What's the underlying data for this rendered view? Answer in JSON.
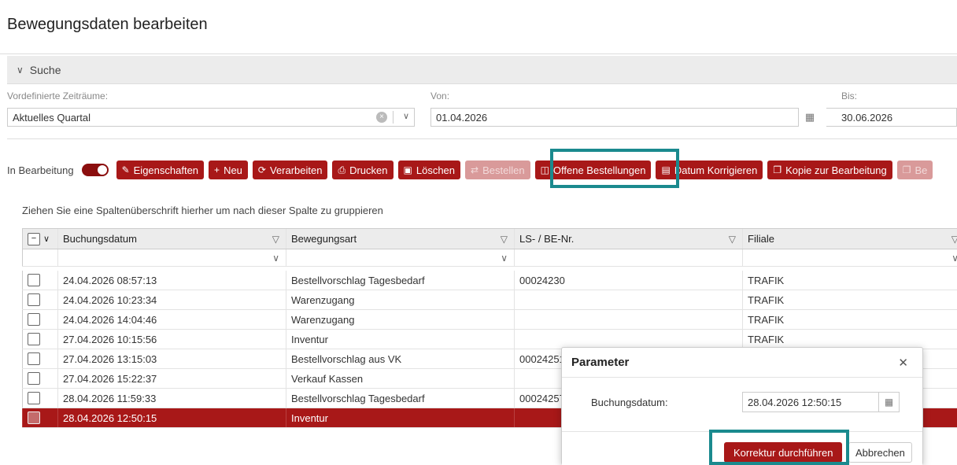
{
  "page": {
    "title": "Bewegungsdaten bearbeiten"
  },
  "search": {
    "header": "Suche",
    "predefined_label": "Vordefinierte Zeiträume:",
    "predefined_value": "Aktuelles Quartal",
    "from_label": "Von:",
    "from_value": "01.04.2026",
    "to_label": "Bis:",
    "to_value": "30.06.2026"
  },
  "toolbar": {
    "in_edit_label": "In Bearbeitung",
    "in_edit_on": true,
    "buttons": {
      "properties": "Eigenschaften",
      "new": "Neu",
      "process": "Verarbeiten",
      "print": "Drucken",
      "delete": "Löschen",
      "order": "Bestellen",
      "open_orders": "Offene Bestellungen",
      "correct_date": "Datum Korrigieren",
      "copy_edit": "Kopie zur Bearbeitung",
      "more": "Be"
    }
  },
  "grid": {
    "group_hint": "Ziehen Sie eine Spaltenüberschrift hierher um nach dieser Spalte zu gruppieren",
    "columns": [
      "Buchungsdatum",
      "Bewegungsart",
      "LS- / BE-Nr.",
      "Filiale"
    ],
    "rows": [
      [
        "24.04.2026 08:57:13",
        "Bestellvorschlag Tagesbedarf",
        "00024230",
        "TRAFIK"
      ],
      [
        "24.04.2026 10:23:34",
        "Warenzugang",
        "",
        "TRAFIK"
      ],
      [
        "24.04.2026 14:04:46",
        "Warenzugang",
        "",
        "TRAFIK"
      ],
      [
        "27.04.2026 10:15:56",
        "Inventur",
        "",
        "TRAFIK"
      ],
      [
        "27.04.2026 13:15:03",
        "Bestellvorschlag aus VK",
        "00024251",
        ""
      ],
      [
        "27.04.2026 15:22:37",
        "Verkauf Kassen",
        "",
        ""
      ],
      [
        "28.04.2026 11:59:33",
        "Bestellvorschlag Tagesbedarf",
        "00024257",
        ""
      ],
      [
        "28.04.2026 12:50:15",
        "Inventur",
        "",
        ""
      ]
    ],
    "selected_row": 7
  },
  "dialog": {
    "title": "Parameter",
    "param_label": "Buchungsdatum:",
    "param_value": "28.04.2026 12:50:15",
    "ok_label": "Korrektur durchführen",
    "cancel_label": "Abbrechen"
  },
  "colors": {
    "accent": "#a81818",
    "highlight": "#1a8a8e"
  }
}
